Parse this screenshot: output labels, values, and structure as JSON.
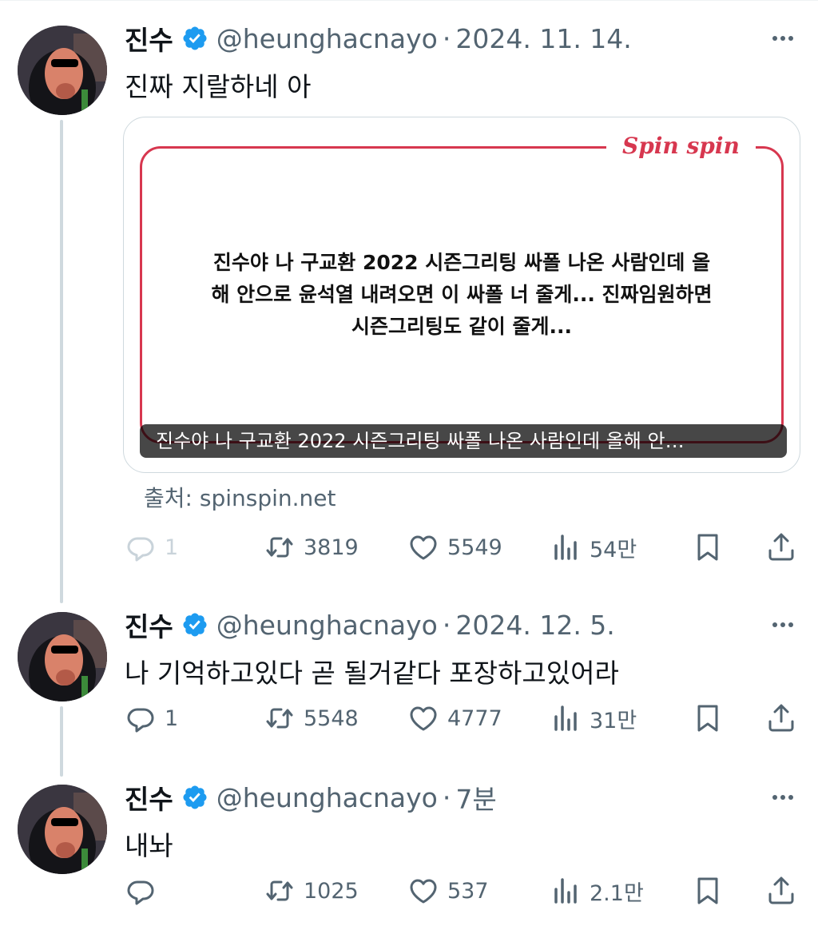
{
  "author": {
    "name": "진수",
    "handle": "@heunghacnayo"
  },
  "separator": "·",
  "tweets": [
    {
      "time": "2024. 11. 14.",
      "text": "진짜 지랄하네 아",
      "card": {
        "logo": "Spin spin",
        "body_line1": "진수야 나 구교환 2022 시즌그리팅 싸폴 나온 사람인데 올",
        "body_line2": "해 안으로 윤석열 내려오면 이 싸폴 너 줄게... 진짜임원하면",
        "body_line3": "시즌그리팅도 같이 줄게...",
        "caption": "진수야 나 구교환 2022 시즌그리팅 싸폴 나온 사람인데 올해 안…",
        "source": "출처: spinspin.net"
      },
      "stats": {
        "replies": "1",
        "retweets": "3819",
        "likes": "5549",
        "views": "54만"
      }
    },
    {
      "time": "2024. 12. 5.",
      "text": "나 기억하고있다 곧 될거같다 포장하고있어라",
      "stats": {
        "replies": "1",
        "retweets": "5548",
        "likes": "4777",
        "views": "31만"
      }
    },
    {
      "time": "7분",
      "text": "내놔",
      "stats": {
        "replies": "",
        "retweets": "1025",
        "likes": "537",
        "views": "2.1만"
      }
    }
  ],
  "colors": {
    "verified": "#1d9bf0",
    "accent_red": "#d7374f",
    "secondary_text": "#536471",
    "thread_line": "#cfd9de"
  },
  "icons": [
    "verified-badge-icon",
    "more-icon",
    "reply-icon",
    "retweet-icon",
    "like-icon",
    "views-icon",
    "bookmark-icon",
    "share-icon"
  ]
}
